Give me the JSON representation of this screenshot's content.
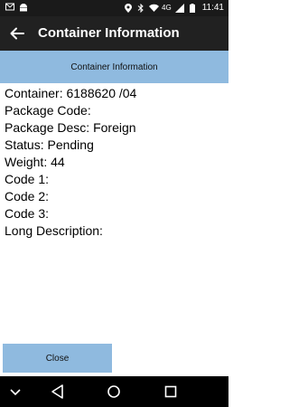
{
  "status_bar": {
    "time": "11:41",
    "network": "4G",
    "left_icons": [
      "mail-icon",
      "android-icon"
    ],
    "right_icons": [
      "location-icon",
      "bluetooth-icon",
      "wifi-icon",
      "signal-icon",
      "battery-icon"
    ]
  },
  "app_bar": {
    "title": "Container Information",
    "back_icon": "arrow-back-icon"
  },
  "section": {
    "header": "Container Information"
  },
  "details": [
    {
      "label": "Container:",
      "value": "6188620 /04"
    },
    {
      "label": "Package Code:",
      "value": ""
    },
    {
      "label": "Package Desc:",
      "value": "Foreign"
    },
    {
      "label": "Status:",
      "value": "Pending"
    },
    {
      "label": "Weight:",
      "value": "44"
    },
    {
      "label": "Code 1:",
      "value": ""
    },
    {
      "label": "Code 2:",
      "value": ""
    },
    {
      "label": "Code 3:",
      "value": ""
    },
    {
      "label": "Long Description:",
      "value": ""
    }
  ],
  "actions": {
    "close_label": "Close"
  },
  "nav_bar": {
    "items": [
      "chevron-down-icon",
      "nav-back-icon",
      "home-icon",
      "recents-icon"
    ]
  },
  "colors": {
    "accent": "#8fbadf",
    "app_bar": "#212121",
    "status_bar": "#1a1a1a"
  }
}
